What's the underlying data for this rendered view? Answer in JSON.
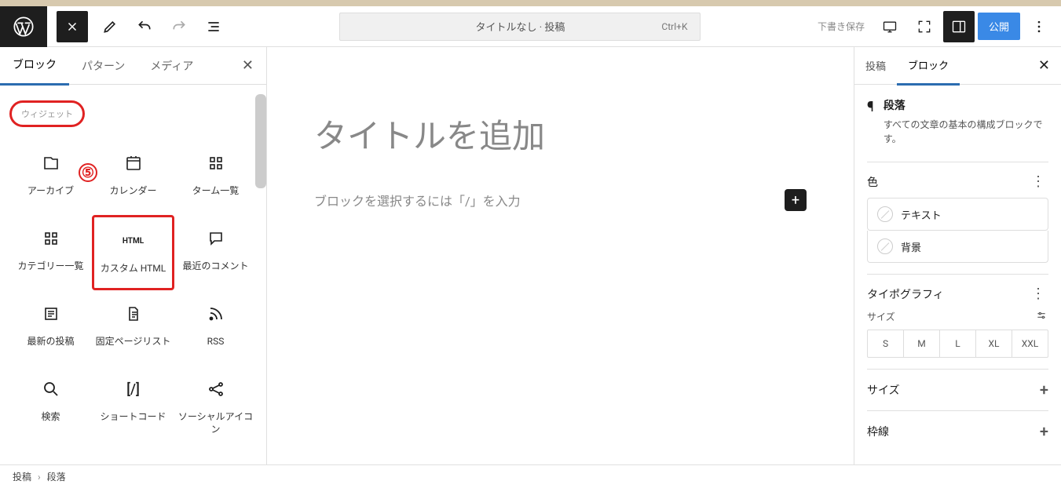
{
  "toolbar": {
    "doc_title": "タイトルなし · 投稿",
    "shortcut": "Ctrl+K",
    "draft_save": "下書き保存",
    "publish": "公開"
  },
  "inserter": {
    "tabs": [
      "ブロック",
      "パターン",
      "メディア"
    ],
    "active_tab": 0,
    "category": "ウィジェット",
    "annotation_number": "⑤",
    "blocks": [
      {
        "label": "アーカイブ",
        "icon": "archive"
      },
      {
        "label": "カレンダー",
        "icon": "calendar"
      },
      {
        "label": "ターム一覧",
        "icon": "grid"
      },
      {
        "label": "カテゴリー一覧",
        "icon": "grid"
      },
      {
        "label": "カスタム HTML",
        "icon": "html"
      },
      {
        "label": "最近のコメント",
        "icon": "comment"
      },
      {
        "label": "最新の投稿",
        "icon": "list"
      },
      {
        "label": "固定ページリスト",
        "icon": "page"
      },
      {
        "label": "RSS",
        "icon": "rss"
      },
      {
        "label": "検索",
        "icon": "search"
      },
      {
        "label": "ショートコード",
        "icon": "shortcode"
      },
      {
        "label": "ソーシャルアイコン",
        "icon": "share"
      }
    ]
  },
  "canvas": {
    "title_placeholder": "タイトルを追加",
    "paragraph_placeholder": "ブロックを選択するには「/」を入力"
  },
  "sidebar": {
    "tabs": [
      "投稿",
      "ブロック"
    ],
    "active_tab": 1,
    "block": {
      "name": "段落",
      "description": "すべての文章の基本の構成ブロックです。"
    },
    "panels": {
      "color": {
        "title": "色",
        "rows": [
          "テキスト",
          "背景"
        ]
      },
      "typography": {
        "title": "タイポグラフィ",
        "size_label": "サイズ",
        "sizes": [
          "S",
          "M",
          "L",
          "XL",
          "XXL"
        ]
      },
      "size": {
        "title": "サイズ"
      },
      "border": {
        "title": "枠線"
      }
    }
  },
  "breadcrumb": [
    "投稿",
    "段落"
  ]
}
